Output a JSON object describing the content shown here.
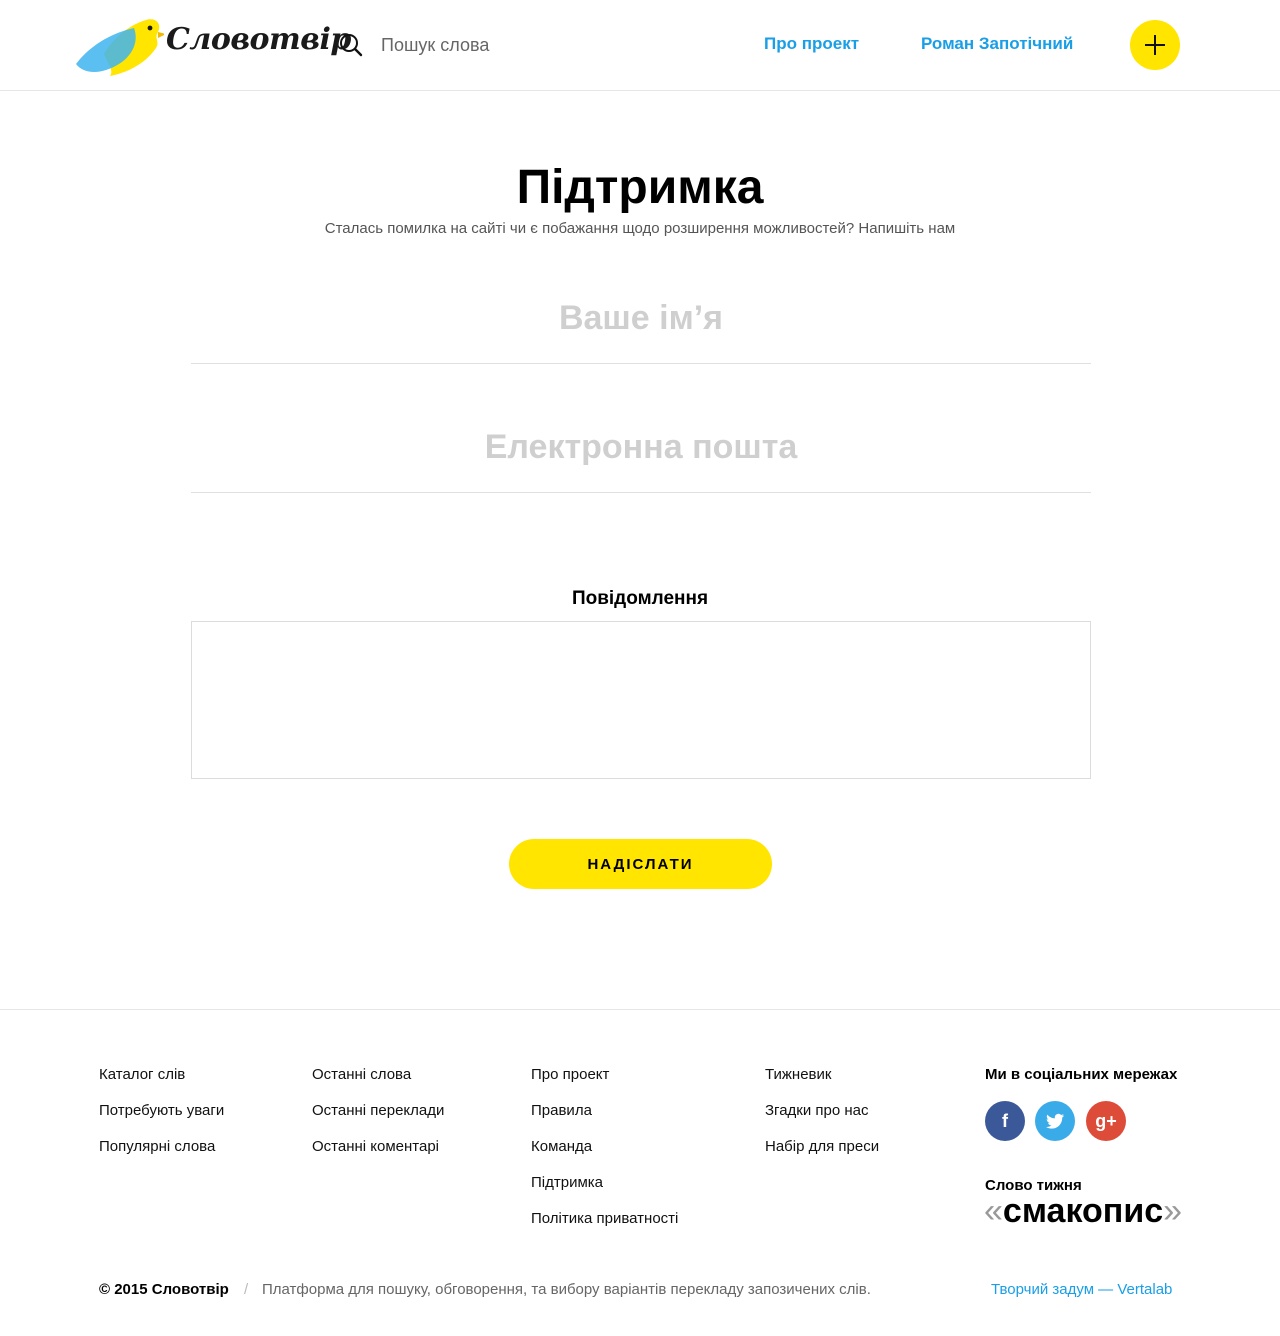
{
  "header": {
    "logo_text": "Словотвір",
    "search_placeholder": "Пошук слова",
    "nav": {
      "about": "Про проект",
      "user": "Роман Запотічний"
    },
    "add_icon": "plus-icon"
  },
  "main": {
    "title": "Підтримка",
    "subtitle": "Сталась помилка на сайті чи є побажання щодо розширення можливостей? Напишіть нам",
    "name_placeholder": "Ваше ім’я",
    "email_placeholder": "Електронна пошта",
    "message_label": "Повідомлення",
    "message_value": "",
    "submit_label": "НАДІСЛАТИ"
  },
  "footer": {
    "col1": [
      "Каталог слів",
      "Потребують уваги",
      "Популярні слова"
    ],
    "col2": [
      "Останні слова",
      "Останні переклади",
      "Останні коментарі"
    ],
    "col3": [
      "Про проект",
      "Правила",
      "Команда",
      "Підтримка",
      "Політика приватності"
    ],
    "col4": [
      "Тижневик",
      "Згадки про нас",
      "Набір для преси"
    ],
    "social_heading": "Ми в соціальних мережах",
    "social_icons": [
      "facebook-icon",
      "twitter-icon",
      "google-plus-icon"
    ],
    "social_glyphs": {
      "facebook": "f",
      "twitter": "t",
      "google": "g+"
    },
    "word_heading": "Слово тижня",
    "word_of_week": "смакопис",
    "quote_open": "«",
    "quote_close": "»",
    "copyright": "© 2015 Словотвір",
    "separator": "/",
    "tagline": "Платформа для пошуку, обговорення, та вибору варіантів перекладу запозичених слів.",
    "credit": "Творчий задум — Vertalab"
  },
  "colors": {
    "accent_yellow": "#ffe500",
    "link_blue": "#1a9ee6",
    "facebook": "#3b5998",
    "twitter": "#3aabe9",
    "google_plus": "#dd4b39"
  }
}
